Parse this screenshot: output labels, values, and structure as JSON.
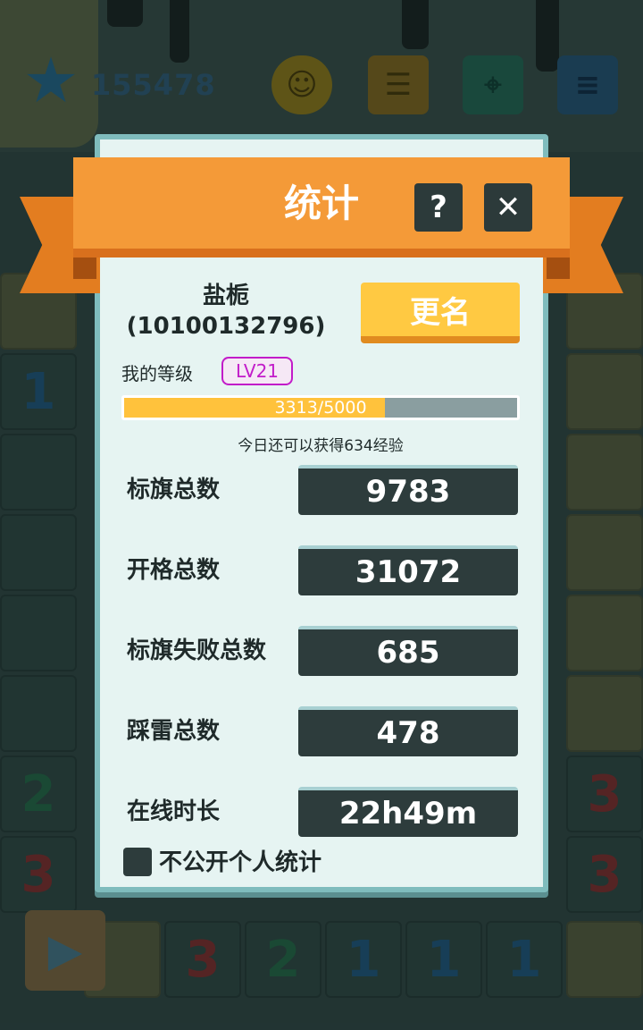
{
  "hud": {
    "score": "155478",
    "star_icon": "star-icon",
    "buttons": [
      "smiley-icon",
      "chat-icon",
      "map-pin-icon",
      "menu-list-icon"
    ]
  },
  "board_numbers": {
    "left_col": [
      "1",
      "2",
      "3"
    ],
    "bottom_row": [
      "3",
      "2",
      "1",
      "1",
      "1"
    ],
    "right_col": [
      "3",
      "3"
    ]
  },
  "dialog": {
    "title": "统计",
    "help_label": "?",
    "close_label": "✕",
    "player_name": "盐栀",
    "player_id": "(10100132796)",
    "rename_label": "更名",
    "level_label": "我的等级",
    "level_value": "LV21",
    "xp_text": "3313/5000",
    "xp_progress": 0.6626,
    "xp_note": "今日还可以获得634经验",
    "stats": [
      {
        "label": "标旗总数",
        "value": "9783"
      },
      {
        "label": "开格总数",
        "value": "31072"
      },
      {
        "label": "标旗失败总数",
        "value": "685"
      },
      {
        "label": "踩雷总数",
        "value": "478"
      },
      {
        "label": "在线时长",
        "value": "22h49m"
      }
    ],
    "private_label": "不公开个人统计"
  },
  "colors": {
    "ribbon": "#f49a38",
    "rename": "#ffc942",
    "level_badge": "#c21cc9",
    "xp_fill": "#ffc23c"
  }
}
